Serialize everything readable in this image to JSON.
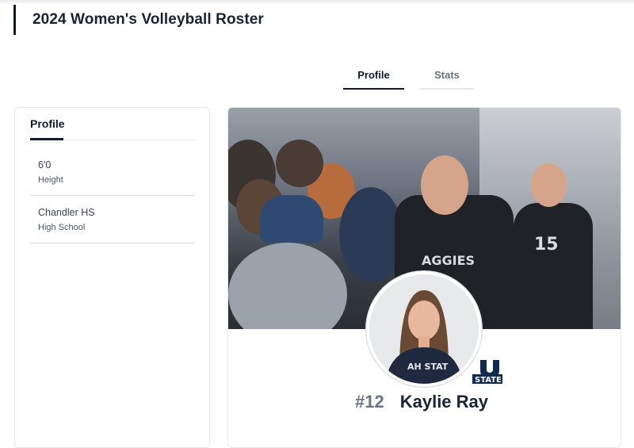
{
  "page": {
    "title": "2024 Women's Volleyball Roster"
  },
  "tabs": [
    {
      "label": "Profile",
      "active": true
    },
    {
      "label": "Stats",
      "active": false
    }
  ],
  "sidebar": {
    "heading": "Profile",
    "items": [
      {
        "value": "6'0",
        "label": "Height"
      },
      {
        "value": "Chandler HS",
        "label": "High School"
      }
    ]
  },
  "player": {
    "number": "#12",
    "name": "Kaylie Ray",
    "logo_text": "STATE",
    "logo_letter": "U"
  },
  "hero": {
    "jersey_text": "AGGIES",
    "jersey_number": "15"
  },
  "colors": {
    "navy": "#0f1a2c",
    "text_dark": "#1b2431",
    "text_muted": "#6b7280",
    "border": "#e6e8eb"
  }
}
